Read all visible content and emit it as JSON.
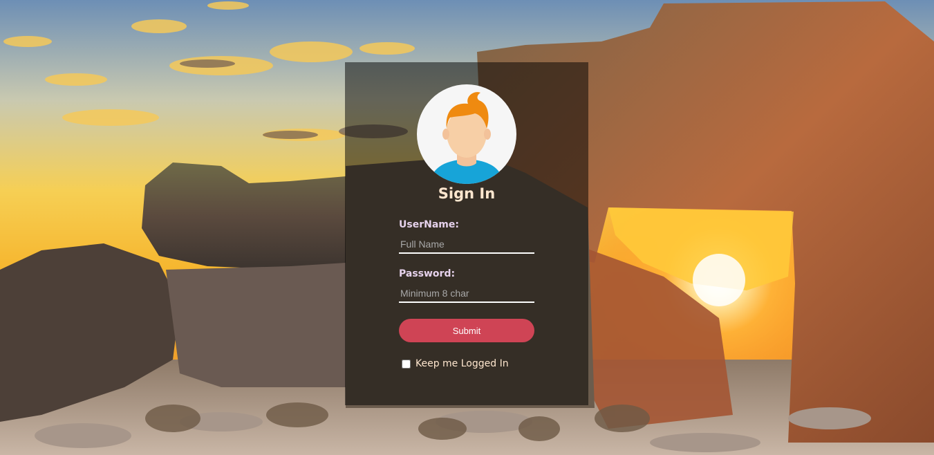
{
  "login": {
    "title": "Sign In",
    "username_label": "UserName:",
    "username_placeholder": "Full Name",
    "password_label": "Password:",
    "password_placeholder": "Minimum 8 char",
    "submit_label": "Submit",
    "remember_label": "Keep me Logged In",
    "remember_checked": false
  },
  "icons": [
    "user-avatar-icon"
  ],
  "colors": {
    "panel": "rgba(0,0,0,0.5)",
    "submit": "#cf4455",
    "title": "#ffe7cf",
    "label": "#e6d2ec"
  }
}
